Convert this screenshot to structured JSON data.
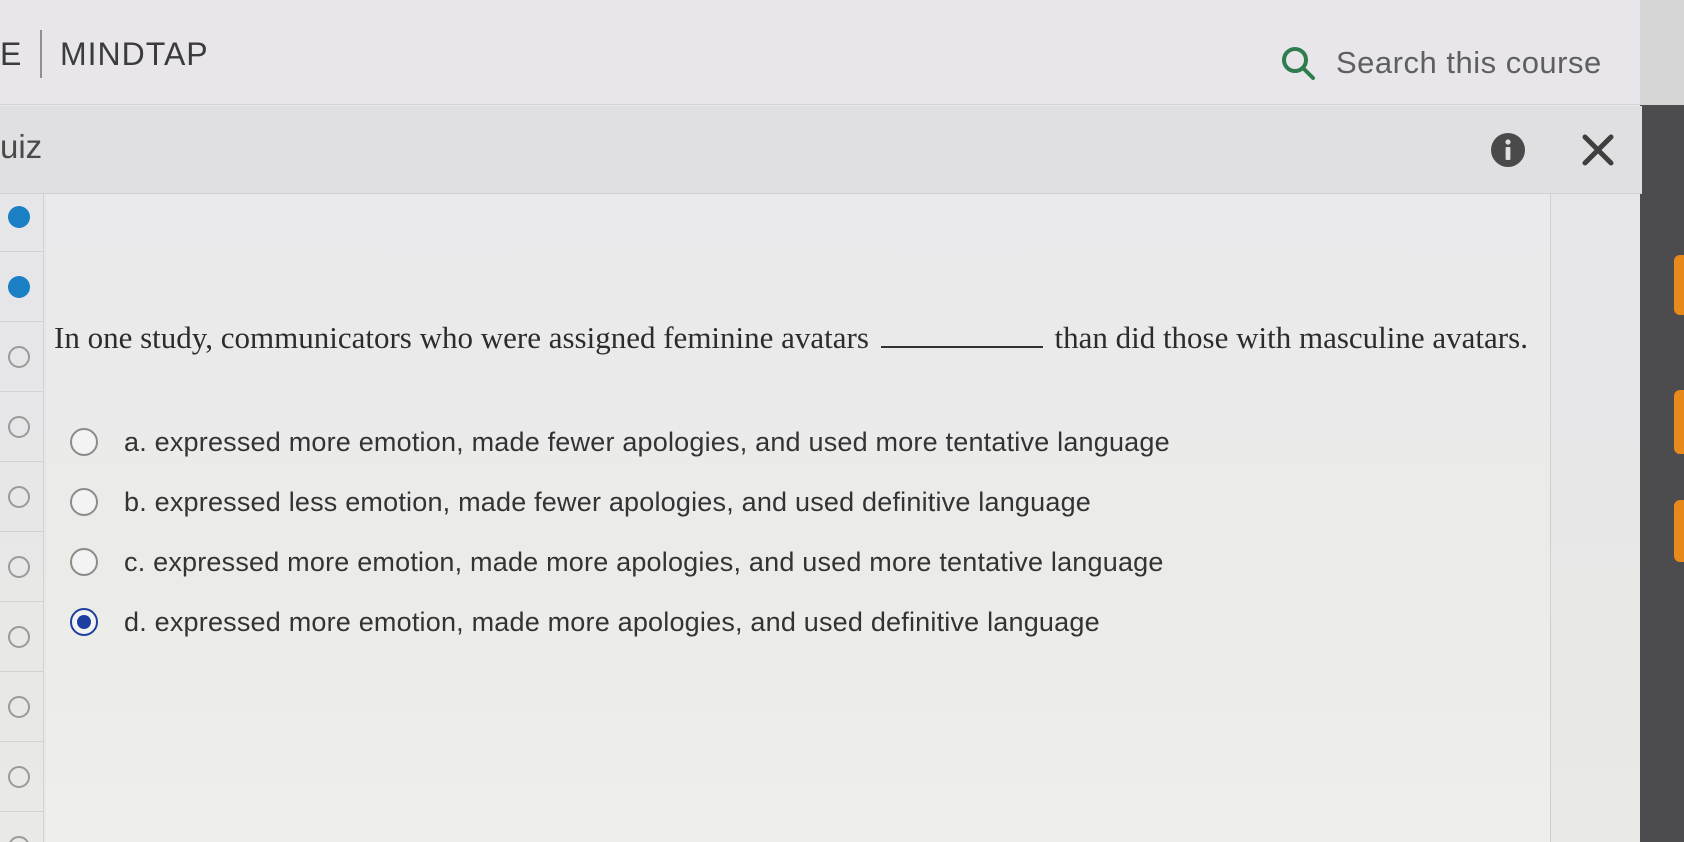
{
  "header": {
    "brand_prefix": "E",
    "brand_name": "MINDTAP",
    "search_placeholder": "Search this course"
  },
  "quiz_bar": {
    "title": "uiz"
  },
  "progress_rail": [
    {
      "state": "done"
    },
    {
      "state": "done"
    },
    {
      "state": "todo"
    },
    {
      "state": "todo"
    },
    {
      "state": "todo"
    },
    {
      "state": "todo"
    },
    {
      "state": "todo"
    },
    {
      "state": "todo"
    },
    {
      "state": "todo"
    },
    {
      "state": "todo"
    }
  ],
  "question": {
    "text_before": "In one study, communicators who were assigned feminine avatars",
    "text_after": "than did those with masculine avatars.",
    "choices": [
      {
        "label": "a. expressed more emotion, made fewer apologies, and used more tentative language",
        "selected": false
      },
      {
        "label": "b. expressed less emotion, made fewer apologies, and used definitive language",
        "selected": false
      },
      {
        "label": "c. expressed more emotion, made more apologies, and used more tentative language",
        "selected": false
      },
      {
        "label": "d. expressed more emotion, made more apologies, and used definitive language",
        "selected": true
      }
    ]
  },
  "colors": {
    "accent_blue": "#1a7fc3",
    "selected_radio": "#1f3fa0",
    "search_icon": "#2e7d4f",
    "orange_tab": "#e8891c"
  },
  "icons": {
    "search": "search-icon",
    "info": "info-icon",
    "close": "close-icon"
  }
}
